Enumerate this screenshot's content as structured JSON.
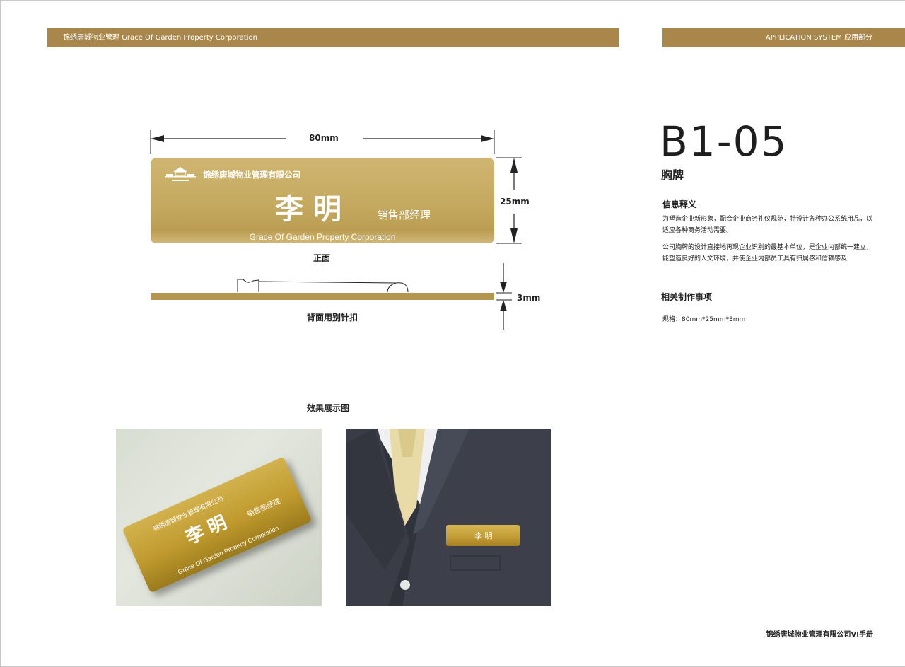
{
  "header": {
    "left_text": "锦绣唐城物业管理  Grace Of Garden Property Corporation",
    "right_text": "APPLICATION SYSTEM   应用部分"
  },
  "drawing": {
    "width_label": "80mm",
    "height_label": "25mm",
    "thickness_label": "3mm",
    "front_caption": "正面",
    "back_caption": "背面用别针扣"
  },
  "badge": {
    "company": "锦绣唐城物业管理有限公司",
    "name": "李明",
    "title": "销售部经理",
    "english": "Grace Of Garden Property Corporation"
  },
  "showcase": {
    "caption": "效果展示图",
    "photo1_company": "锦绣唐城物业管理有限公司",
    "photo1_name": "李明",
    "photo1_title": "销售部经理",
    "photo1_english": "Grace Of Garden Property Corporation",
    "photo2_name": "李 明"
  },
  "right_panel": {
    "code": "B1-05",
    "subtitle": "胸牌",
    "info_heading": "信息释义",
    "info_para1": "为塑造企业新形象，配合企业商务礼仪规范，特设计各种办公系统用品，以适应各种商务活动需要。",
    "info_para2": "公司胸牌的设计直接地再现企业识别的最基本单位，是企业内部统一建立，能塑造良好的人文环境，并使企业内部员工具有归属感和信赖感及",
    "production_heading": "相关制作事项",
    "spec": "规格：80mm*25mm*3mm"
  },
  "footer": {
    "text": "锦绣唐城物业管理有限公司VI手册"
  },
  "colors": {
    "header_gold": "#a9874a",
    "badge_gold": "#c4a95f"
  }
}
